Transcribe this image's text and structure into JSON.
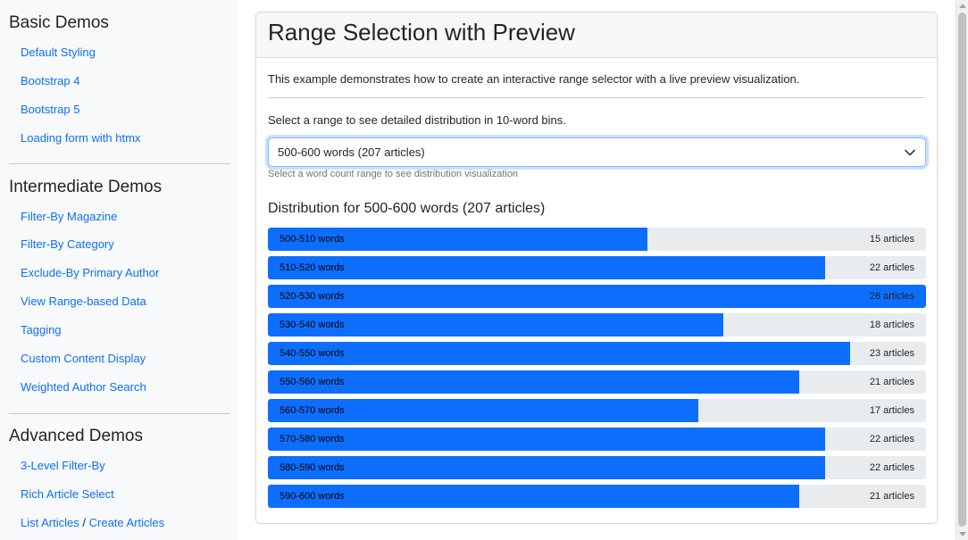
{
  "sidebar": {
    "basic": {
      "title": "Basic Demos",
      "items": [
        "Default Styling",
        "Bootstrap 4",
        "Bootstrap 5",
        "Loading form with htmx"
      ]
    },
    "intermediate": {
      "title": "Intermediate Demos",
      "items": [
        "Filter-By Magazine",
        "Filter-By Category",
        "Exclude-By Primary Author",
        "View Range-based Data",
        "Tagging",
        "Custom Content Display",
        "Weighted Author Search"
      ]
    },
    "advanced": {
      "title": "Advanced Demos",
      "items": [
        "3-Level Filter-By",
        "Rich Article Select"
      ],
      "last_row": {
        "link_a": "List Articles",
        "separator": "/",
        "link_b": "Create Articles"
      }
    }
  },
  "main": {
    "title": "Range Selection with Preview",
    "intro": "This example demonstrates how to create an interactive range selector with a live preview visualization.",
    "prompt": "Select a range to see detailed distribution in 10-word bins.",
    "select": {
      "value": "500-600 words (207 articles)"
    },
    "help": "Select a word count range to see distribution visualization",
    "distribution_title": "Distribution for 500-600 words (207 articles)"
  },
  "chart_data": {
    "type": "bar",
    "orientation": "horizontal",
    "categories": [
      "500-510 words",
      "510-520 words",
      "520-530 words",
      "530-540 words",
      "540-550 words",
      "550-560 words",
      "560-570 words",
      "570-580 words",
      "580-590 words",
      "590-600 words"
    ],
    "values": [
      15,
      22,
      26,
      18,
      23,
      21,
      17,
      22,
      22,
      21
    ],
    "value_labels": [
      "15 articles",
      "22 articles",
      "26 articles",
      "18 articles",
      "23 articles",
      "21 articles",
      "17 articles",
      "22 articles",
      "22 articles",
      "21 articles"
    ],
    "xlim": [
      0,
      26
    ]
  },
  "colors": {
    "accent": "#0d6efd",
    "track": "#e9ecef",
    "link": "#0d6efd"
  }
}
